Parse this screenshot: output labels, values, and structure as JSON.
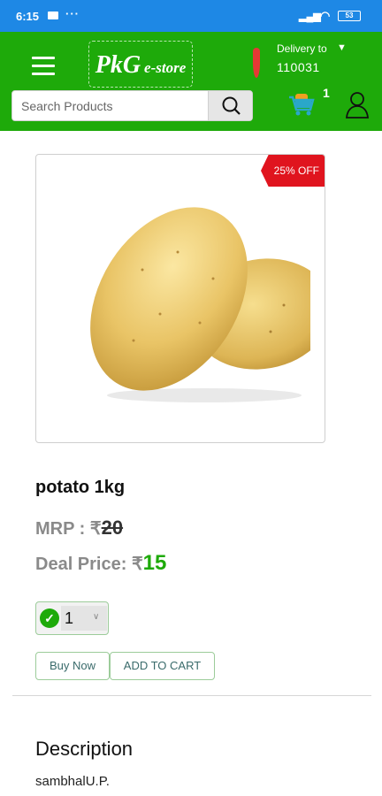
{
  "status_bar": {
    "time": "6:15",
    "more": "···",
    "battery": "53"
  },
  "header": {
    "logo_main": "PkG",
    "logo_sub": "e-store",
    "delivery_label": "Delivery to",
    "pincode": "110031",
    "search_placeholder": "Search Products",
    "cart_count": "1"
  },
  "product": {
    "discount_badge": "25% OFF",
    "title": "potato 1kg",
    "mrp_label": "MRP : ₹",
    "mrp_value": "20",
    "deal_label": "Deal Price: ₹",
    "deal_value": "15",
    "quantity": "1",
    "buy_now_label": "Buy Now",
    "add_to_cart_label": "ADD TO CART",
    "description_heading": "Description",
    "description_text": "sambhalU.P."
  },
  "colors": {
    "header_green": "#1eaa0a",
    "status_blue": "#1e88e5",
    "discount_red": "#e0141e",
    "price_green": "#1eaa0a"
  },
  "icons": [
    "menu-icon",
    "location-pin-icon",
    "search-icon",
    "cart-icon",
    "user-icon",
    "check-icon",
    "chevron-down-icon"
  ]
}
